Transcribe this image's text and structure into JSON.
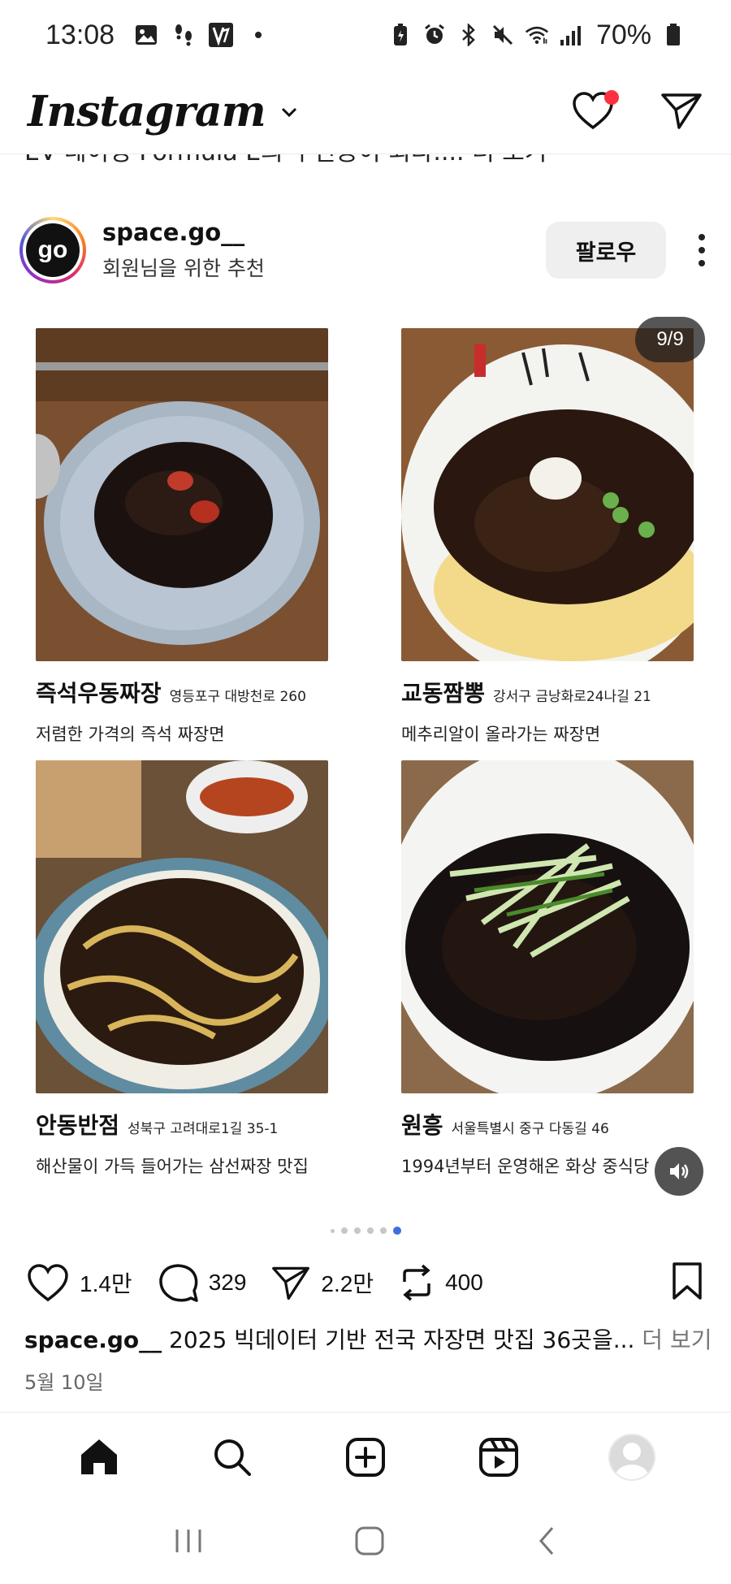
{
  "status_bar": {
    "time": "13:08",
    "battery": "70%",
    "left_icons": [
      "image-icon",
      "footprint-icon",
      "app-v-icon",
      "dot-icon"
    ],
    "right_icons": [
      "battery-saver-icon",
      "alarm-icon",
      "bluetooth-icon",
      "mute-icon",
      "wifi-icon",
      "signal-icon",
      "battery-icon"
    ]
  },
  "header": {
    "logo": "Instagram",
    "notification_color": "#ff3040"
  },
  "clipped_caption": "EV 레이싱 Formula E의 주인공이 되다.... 더 보기",
  "post": {
    "username": "space.go__",
    "avatar_text": "go",
    "subtitle": "회원님을 위한 추천",
    "follow_label": "팔로우"
  },
  "carousel": {
    "counter": "9/9",
    "cards": [
      {
        "title": "즉석우동짜장",
        "address": "영등포구 대방천로 260",
        "desc": "저렴한 가격의 즉석 짜장면"
      },
      {
        "title": "교동짬뽕",
        "address": "강서구 금낭화로24나길 21",
        "desc": "메추리알이 올라가는 짜장면"
      },
      {
        "title": "안동반점",
        "address": "성북구 고려대로1길 35-1",
        "desc": "해산물이 가득 들어가는 삼선짜장 맛집"
      },
      {
        "title": "원흥",
        "address": "서울특별시 중구 다동길 46",
        "desc": "1994년부터 운영해온 화상 중식당"
      }
    ],
    "active_dot_color": "#3f6ee0"
  },
  "actions": {
    "likes": "1.4만",
    "comments": "329",
    "shares": "2.2만",
    "reposts": "400"
  },
  "caption": {
    "username": "space.go__",
    "text": " 2025 빅데이터 기반 전국 자장면 맛집 36곳을...",
    "more": " 더 보기"
  },
  "date": "5월 10일"
}
